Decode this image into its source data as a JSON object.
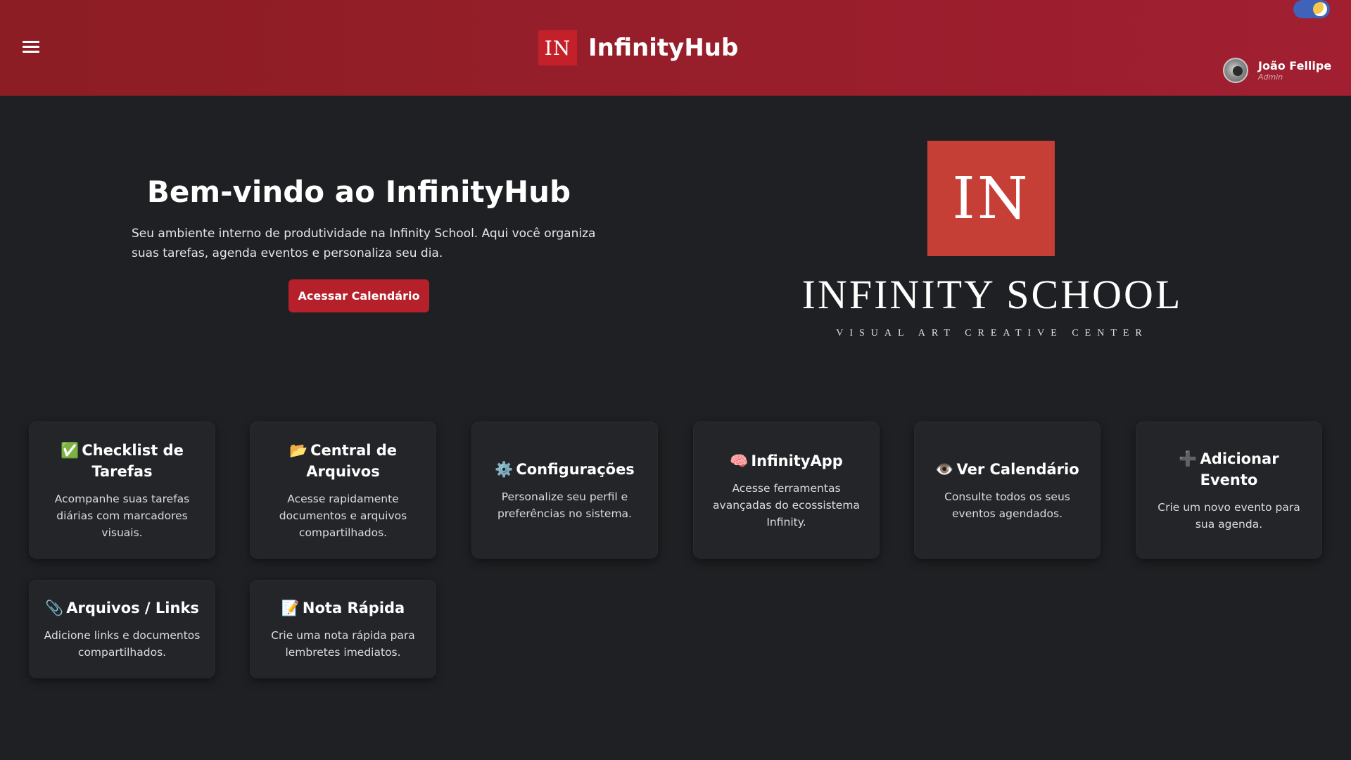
{
  "header": {
    "logo_text": "IN",
    "app_name": "InfinityHub",
    "menu_icon": "hamburger-menu-icon",
    "theme_toggle_icon": "moon-icon",
    "user": {
      "name": "João Fellipe",
      "role": "Admin"
    }
  },
  "hero": {
    "title": "Bem-vindo ao InfinityHub",
    "description": "Seu ambiente interno de produtividade na Infinity School. Aqui você organiza suas tarefas, agenda eventos e personaliza seu dia.",
    "button_label": "Acessar Calendário"
  },
  "school_logo": {
    "mark": "IN",
    "name": "INFINITY SCHOOL",
    "tagline": "VISUAL ART CREATIVE CENTER"
  },
  "cards": [
    {
      "icon": "✅",
      "icon_name": "check-icon",
      "title": "Checklist de Tarefas",
      "description": "Acompanhe suas tarefas diárias com marcadores visuais."
    },
    {
      "icon": "📂",
      "icon_name": "folder-icon",
      "title": "Central de Arquivos",
      "description": "Acesse rapidamente documentos e arquivos compartilhados."
    },
    {
      "icon": "⚙️",
      "icon_name": "gear-icon",
      "title": "Configurações",
      "description": "Personalize seu perfil e preferências no sistema."
    },
    {
      "icon": "🧠",
      "icon_name": "brain-icon",
      "title": "InfinityApp",
      "description": "Acesse ferramentas avançadas do ecossistema Infinity."
    },
    {
      "icon": "👁️",
      "icon_name": "eye-icon",
      "title": "Ver Calendário",
      "description": "Consulte todos os seus eventos agendados."
    },
    {
      "icon": "➕",
      "icon_name": "plus-icon",
      "title": "Adicionar Evento",
      "description": "Crie um novo evento para sua agenda."
    },
    {
      "icon": "📎",
      "icon_name": "paperclip-icon",
      "title": "Arquivos / Links",
      "description": "Adicione links e documentos compartilhados."
    },
    {
      "icon": "📝",
      "icon_name": "memo-icon",
      "title": "Nota Rápida",
      "description": "Crie uma nota rápida para lembretes imediatos."
    }
  ],
  "colors": {
    "header_start": "#8c1d24",
    "header_end": "#a11f31",
    "accent": "#b5202a",
    "logo_bg": "#c63f36",
    "background": "#1f2023",
    "card_bg": "#242529"
  }
}
